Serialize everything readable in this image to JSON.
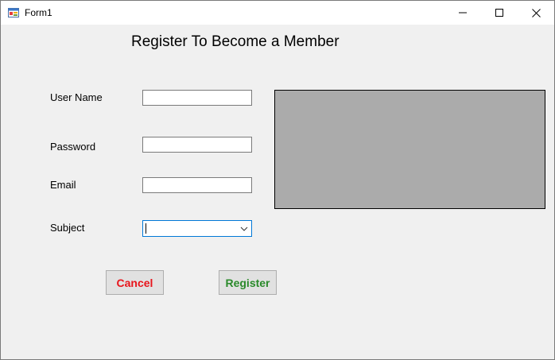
{
  "window": {
    "title": "Form1"
  },
  "form": {
    "heading": "Register To Become a Member",
    "labels": {
      "username": "User Name",
      "password": "Password",
      "email": "Email",
      "subject": "Subject"
    },
    "fields": {
      "username": "",
      "password": "",
      "email": "",
      "subject": ""
    },
    "buttons": {
      "cancel": "Cancel",
      "register": "Register"
    }
  },
  "colors": {
    "cancel_text": "#e8141b",
    "register_text": "#2a8a2a",
    "picture_fill": "#ababab",
    "focus_border": "#0078d7"
  },
  "icons": {
    "app": "form-app-icon",
    "minimize": "minimize-icon",
    "maximize": "maximize-icon",
    "close": "close-icon",
    "dropdown": "chevron-down-icon"
  }
}
